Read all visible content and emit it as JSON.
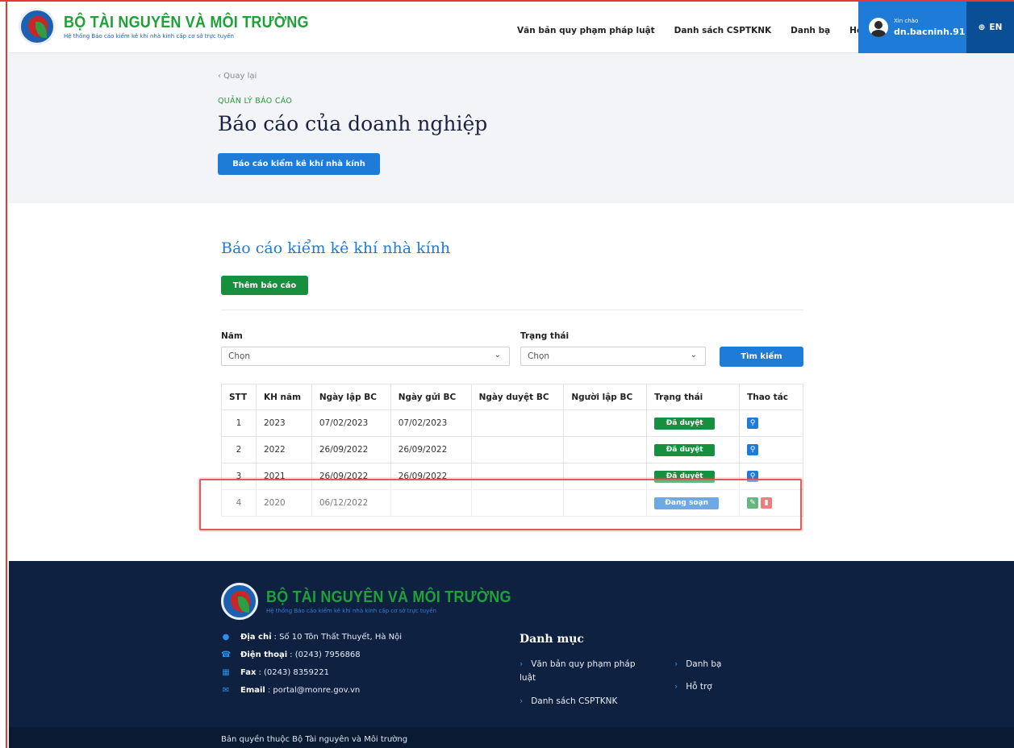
{
  "header": {
    "org_title": "BỘ TÀI NGUYÊN VÀ MÔI TRƯỜNG",
    "org_subtitle": "Hệ thống Báo cáo kiểm kê khí nhà kính cấp cơ sở trực tuyến",
    "nav": [
      "Văn bản quy phạm pháp luật",
      "Danh sách CSPTKNK",
      "Danh bạ",
      "Hỗ trợ"
    ],
    "greeting": "Xin chào",
    "username": "dn.bacninh.91",
    "lang": "EN"
  },
  "top": {
    "back_label": "‹ Quay lại",
    "section_label": "QUẢN LÝ BÁO CÁO",
    "page_title": "Báo cáo của doanh nghiệp",
    "primary_button": "Báo cáo kiểm kê khí nhà kính"
  },
  "main": {
    "section_title": "Báo cáo kiểm kê khí nhà kính",
    "add_button": "Thêm báo cáo",
    "filters": {
      "year_label": "Năm",
      "year_value": "Chọn",
      "status_label": "Trạng thái",
      "status_value": "Chọn",
      "search_button": "Tìm kiếm"
    },
    "table": {
      "columns": [
        "STT",
        "KH năm",
        "Ngày lập BC",
        "Ngày gửi BC",
        "Ngày duyệt BC",
        "Người lập BC",
        "Trạng thái",
        "Thao tác"
      ],
      "rows": [
        {
          "stt": "1",
          "year": "2023",
          "created": "07/02/2023",
          "sent": "07/02/2023",
          "approved": "",
          "creator": "",
          "status": "Đã duyệt"
        },
        {
          "stt": "2",
          "year": "2022",
          "created": "26/09/2022",
          "sent": "26/09/2022",
          "approved": "",
          "creator": "",
          "status": "Đã duyệt"
        },
        {
          "stt": "3",
          "year": "2021",
          "created": "26/09/2022",
          "sent": "26/09/2022",
          "approved": "",
          "creator": "",
          "status": "Đã duyệt"
        },
        {
          "stt": "4",
          "year": "2020",
          "created": "06/12/2022",
          "sent": "",
          "approved": "",
          "creator": "",
          "status": "Đang soạn"
        }
      ]
    }
  },
  "footer": {
    "org_title": "BỘ TÀI NGUYÊN VÀ MÔI TRƯỜNG",
    "org_subtitle": "Hệ thống Báo cáo kiểm kê khí nhà kính cấp cơ sở trực tuyến",
    "address_label": "Địa chỉ",
    "address": ": Số 10 Tôn Thất Thuyết, Hà Nội",
    "phone_label": "Điện thoại",
    "phone": ": (0243) 7956868",
    "fax_label": "Fax",
    "fax": ": (0243) 8359221",
    "email_label": "Email",
    "email": ": portal@monre.gov.vn",
    "menu_title": "Danh mục",
    "menu_links": [
      "Văn bản quy phạm pháp",
      "luật",
      "Danh sách CSPTKNK",
      "Danh bạ",
      "Hỗ trợ"
    ],
    "copyright": "Bản quyền thuộc Bộ Tài nguyên và Môi trường"
  },
  "colors": {
    "brand_green": "#1fa038",
    "brand_blue": "#1e7bd8",
    "footer_bg": "#0f2140",
    "highlight_red": "#e05a5a"
  }
}
